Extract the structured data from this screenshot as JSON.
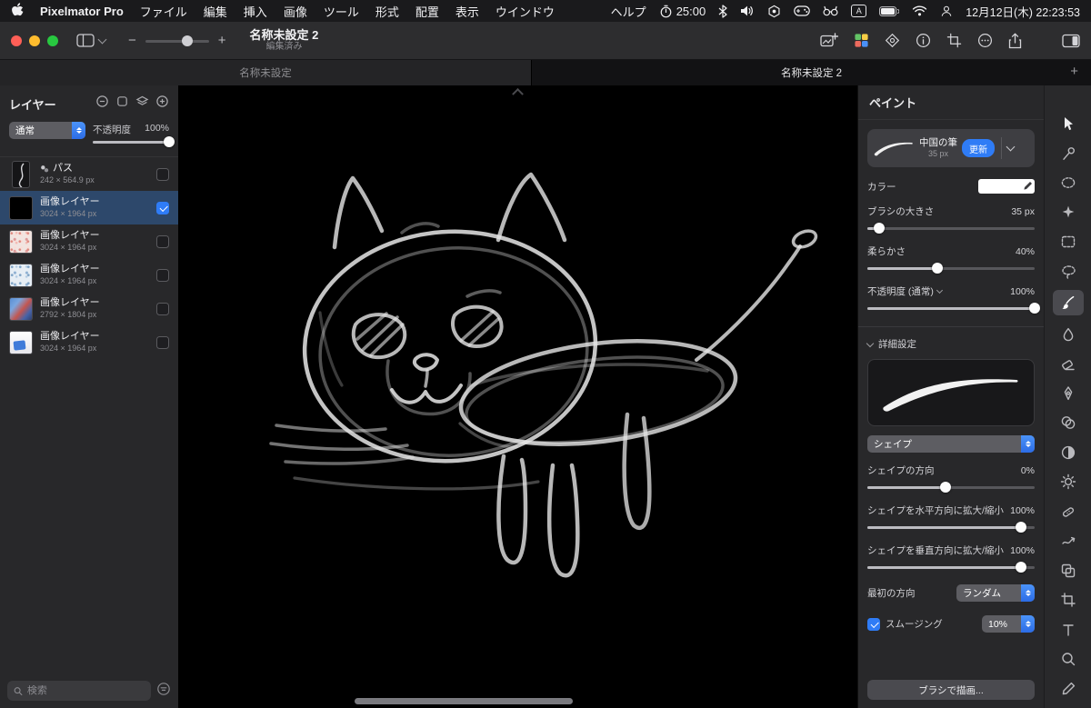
{
  "menubar": {
    "app_name": "Pixelmator Pro",
    "menus": [
      "ファイル",
      "編集",
      "挿入",
      "画像",
      "ツール",
      "形式",
      "配置",
      "表示",
      "ウインドウ"
    ],
    "help": "ヘルプ",
    "timer": "25:00",
    "input_source": "A",
    "datetime": "12月12日(木) 22:23:53",
    "status_icons": [
      "timer-icon",
      "bluetooth-icon",
      "volume-icon",
      "hexagon-icon",
      "controller-icon",
      "binoculars-icon",
      "input-source-badge",
      "battery-icon",
      "wifi-icon",
      "user-switch-icon"
    ]
  },
  "titlebar": {
    "doc_title": "名称未設定 2",
    "doc_status": "編集済み",
    "zoom_minus": "−",
    "zoom_plus": "+",
    "right_icons": [
      "add-image-icon",
      "color-swatches-icon",
      "effects-icon",
      "info-icon",
      "crop-icon",
      "more-icon",
      "share-icon",
      "sidebar-toggle-icon"
    ]
  },
  "tabs": {
    "tab1": "名称未設定",
    "tab2": "名称未設定 2",
    "new_tab": "+"
  },
  "layers_panel": {
    "title": "レイヤー",
    "blend_mode": "通常",
    "opacity_label": "不透明度",
    "opacity_value": "100%",
    "search_placeholder": "検索",
    "layers": [
      {
        "name": "パス",
        "size": "242 × 564.9 px",
        "checked": false,
        "selected": false
      },
      {
        "name": "画像レイヤー",
        "size": "3024 × 1964 px",
        "checked": true,
        "selected": true
      },
      {
        "name": "画像レイヤー",
        "size": "3024 × 1964 px",
        "checked": false,
        "selected": false
      },
      {
        "name": "画像レイヤー",
        "size": "3024 × 1964 px",
        "checked": false,
        "selected": false
      },
      {
        "name": "画像レイヤー",
        "size": "2792 × 1804 px",
        "checked": false,
        "selected": false
      },
      {
        "name": "画像レイヤー",
        "size": "3024 × 1964 px",
        "checked": false,
        "selected": false
      }
    ]
  },
  "paint_panel": {
    "title": "ペイント",
    "brush": {
      "name": "中国の筆",
      "size_caption": "35 px",
      "update_label": "更新"
    },
    "color_label": "カラー",
    "size_label": "ブラシの大きさ",
    "size_value": "35 px",
    "softness_label": "柔らかさ",
    "softness_value": "40%",
    "opacity_label": "不透明度 (通常)",
    "opacity_value": "100%",
    "details_label": "詳細設定",
    "shape_popup": "シェイプ",
    "shape_dir_label": "シェイプの方向",
    "shape_dir_value": "0%",
    "scale_h_label": "シェイプを水平方向に拡大/縮小",
    "scale_h_value": "100%",
    "scale_v_label": "シェイプを垂直方向に拡大/縮小",
    "scale_v_value": "100%",
    "first_dir_label": "最初の方向",
    "first_dir_value": "ランダム",
    "smoothing_label": "スムージング",
    "smoothing_value": "10%",
    "draw_button": "ブラシで描画..."
  },
  "accent_colors": {
    "blue": "#2f7cf6",
    "selection_row": "#2d486b"
  },
  "tools": [
    "arrange-tool",
    "style-tool",
    "select-oval-tool",
    "magic-wand-tool",
    "rect-select-tool",
    "lasso-tool",
    "paint-tool",
    "color-fill-tool",
    "erase-tool",
    "pen-tool",
    "shape-tool",
    "gradient-tool",
    "adjust-tool",
    "retouch-tool",
    "warp-tool",
    "clone-tool",
    "crop-tool",
    "type-tool",
    "zoom-tool",
    "color-pick-tool"
  ]
}
